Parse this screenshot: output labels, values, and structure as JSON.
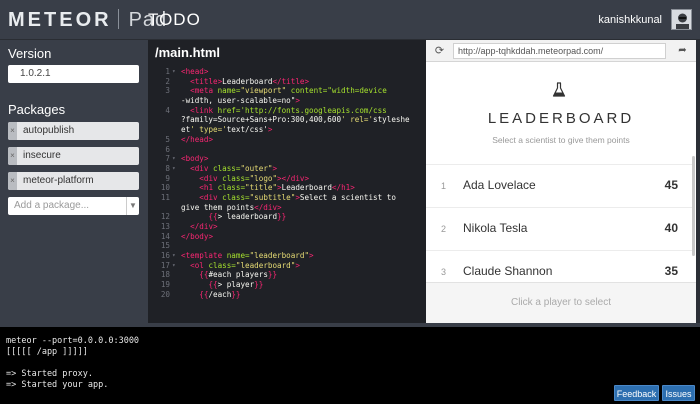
{
  "header": {
    "logo_meteor": "METE",
    "logo_meteor_end": "R",
    "logo_pad": "Pad",
    "app_title": "TODO",
    "username": "kanishkkunal"
  },
  "sidebar": {
    "version_heading": "Version",
    "version_value": "1.0.2.1",
    "packages_heading": "Packages",
    "packages": [
      {
        "name": "autopublish"
      },
      {
        "name": "insecure"
      },
      {
        "name": "meteor-platform"
      }
    ],
    "add_package_placeholder": "Add a package..."
  },
  "editor": {
    "filename": "/main.html",
    "lines": [
      {
        "n": "1",
        "fold": true
      },
      {
        "n": "2",
        "fold": false
      },
      {
        "n": "3",
        "fold": false
      },
      {
        "n": "",
        "fold": false
      },
      {
        "n": "4",
        "fold": false
      },
      {
        "n": "",
        "fold": false
      },
      {
        "n": "",
        "fold": false
      },
      {
        "n": "5",
        "fold": false
      },
      {
        "n": "6",
        "fold": false
      },
      {
        "n": "7",
        "fold": true
      },
      {
        "n": "8",
        "fold": true
      },
      {
        "n": "9",
        "fold": false
      },
      {
        "n": "10",
        "fold": false
      },
      {
        "n": "11",
        "fold": false
      },
      {
        "n": "",
        "fold": false
      },
      {
        "n": "12",
        "fold": false
      },
      {
        "n": "13",
        "fold": false
      },
      {
        "n": "14",
        "fold": false
      },
      {
        "n": "15",
        "fold": false
      },
      {
        "n": "16",
        "fold": true
      },
      {
        "n": "17",
        "fold": true
      },
      {
        "n": "18",
        "fold": false
      },
      {
        "n": "19",
        "fold": false
      },
      {
        "n": "20",
        "fold": false
      }
    ],
    "code": [
      "<head>",
      "  <title>Leaderboard</title>",
      "  <meta name=\"viewport\" content=\"width=device",
      "-width, user-scalable=no\">",
      "  <link href='http://fonts.googleapis.com/css",
      "?family=Source+Sans+Pro:300,400,600' rel='styleshe",
      "et' type='text/css'>",
      "</head>",
      "",
      "<body>",
      "  <div class=\"outer\">",
      "    <div class=\"logo\"></div>",
      "    <h1 class=\"title\">Leaderboard</h1>",
      "    <div class=\"subtitle\">Select a scientist to",
      "give them points</div>",
      "      {{> leaderboard}}",
      "  </div>",
      "</body>",
      "",
      "<template name=\"leaderboard\">",
      "  <ol class=\"leaderboard\">",
      "    {{#each players}}",
      "      {{> player}}",
      "    {{/each}}"
    ]
  },
  "browser": {
    "url": "http://app-tqhkddah.meteorpad.com/",
    "title": "LEADERBOARD",
    "subtitle": "Select a scientist to give them points",
    "players": [
      {
        "rank": "1",
        "name": "Ada Lovelace",
        "score": "45"
      },
      {
        "rank": "2",
        "name": "Nikola Tesla",
        "score": "40"
      },
      {
        "rank": "3",
        "name": "Claude Shannon",
        "score": "35"
      }
    ],
    "footer": "Click a player to select"
  },
  "console": {
    "lines": [
      "meteor --port=0.0.0.0:3000",
      "[[[[[ /app ]]]]]",
      "",
      "=> Started proxy.",
      "=> Started your app."
    ]
  },
  "buttons": {
    "feedback": "Feedback",
    "issues": "Issues"
  },
  "colors": {
    "topbar": "#393e48",
    "editor_bg": "#1f2126",
    "button_blue": "#2d6fb0"
  }
}
